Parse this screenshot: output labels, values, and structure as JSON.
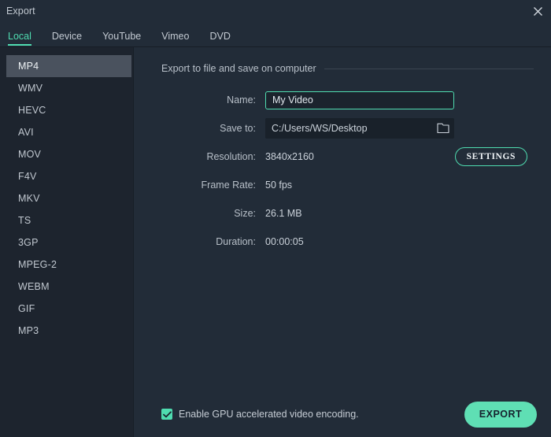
{
  "window": {
    "title": "Export",
    "close_icon": "close-icon"
  },
  "tabs": [
    {
      "label": "Local",
      "active": true
    },
    {
      "label": "Device",
      "active": false
    },
    {
      "label": "YouTube",
      "active": false
    },
    {
      "label": "Vimeo",
      "active": false
    },
    {
      "label": "DVD",
      "active": false
    }
  ],
  "sidebar": {
    "formats": [
      {
        "label": "MP4",
        "selected": true
      },
      {
        "label": "WMV",
        "selected": false
      },
      {
        "label": "HEVC",
        "selected": false
      },
      {
        "label": "AVI",
        "selected": false
      },
      {
        "label": "MOV",
        "selected": false
      },
      {
        "label": "F4V",
        "selected": false
      },
      {
        "label": "MKV",
        "selected": false
      },
      {
        "label": "TS",
        "selected": false
      },
      {
        "label": "3GP",
        "selected": false
      },
      {
        "label": "MPEG-2",
        "selected": false
      },
      {
        "label": "WEBM",
        "selected": false
      },
      {
        "label": "GIF",
        "selected": false
      },
      {
        "label": "MP3",
        "selected": false
      }
    ]
  },
  "main": {
    "section_title": "Export to file and save on computer",
    "fields": {
      "name_label": "Name:",
      "name_value": "My Video",
      "name_placeholder": "My Video",
      "saveto_label": "Save to:",
      "saveto_value": "C:/Users/WS/Desktop",
      "folder_icon": "folder-icon",
      "resolution_label": "Resolution:",
      "resolution_value": "3840x2160",
      "settings_button": "SETTINGS",
      "framerate_label": "Frame Rate:",
      "framerate_value": "50 fps",
      "size_label": "Size:",
      "size_value": "26.1 MB",
      "duration_label": "Duration:",
      "duration_value": "00:00:05"
    }
  },
  "bottom": {
    "gpu_label": "Enable GPU accelerated video encoding.",
    "gpu_checked": true,
    "export_button": "EXPORT"
  },
  "colors": {
    "accent": "#4fdcb0",
    "accent_solid": "#5fdfb4",
    "window_bg": "#222c38",
    "sidebar_bg": "#1d242e",
    "selected_row": "#4a525e",
    "input_bg": "#1b232d",
    "path_bg": "#19212a",
    "text": "#c8cfd6"
  }
}
